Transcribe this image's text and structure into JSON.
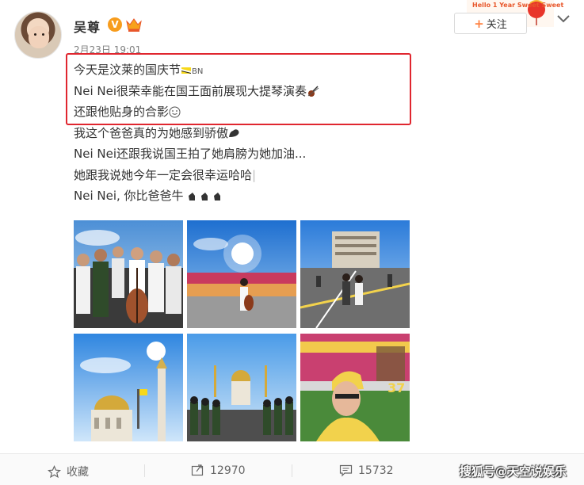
{
  "user": {
    "name": "吴尊",
    "verified_badge": "V",
    "timestamp": "2月23日 19:01"
  },
  "header": {
    "follow_label": "关注",
    "plus_icon": "+",
    "banner_text": "Hello 1 Year Sweet Sweet"
  },
  "post": {
    "lines": [
      "今天是汶莱的国庆节",
      "Nei Nei很荣幸能在国王面前展现大提琴演奏",
      "还跟他贴身的合影",
      "我这个爸爸真的为她感到骄傲",
      "Nei Nei还跟我说国王拍了她肩膀为她加油...",
      "她跟我说她今年一定会很幸运哈哈",
      "Nei Nei, 你比爸爸牛"
    ],
    "flag_suffix": "BN",
    "cursor": "|"
  },
  "photos": [
    {
      "name": "photo-group-cello"
    },
    {
      "name": "photo-stage-performance"
    },
    {
      "name": "photo-street-parade"
    },
    {
      "name": "photo-mosque"
    },
    {
      "name": "photo-guards-parade"
    },
    {
      "name": "photo-selfie-stadium"
    }
  ],
  "toolbar": {
    "favorite_label": "收藏",
    "repost_count": "12970",
    "comment_count": "15732",
    "watermark": "搜狐号@天空说娱乐"
  },
  "colors": {
    "highlight_box": "#e0262f",
    "verified": "#f79c1d",
    "follow_plus": "#ff8140"
  },
  "icons": [
    "star-icon",
    "repost-icon",
    "comment-icon",
    "chevron-down-icon",
    "crown-icon",
    "violin-icon",
    "muscle-icon",
    "thumbs-icon",
    "flag-icon",
    "smile-icon"
  ]
}
